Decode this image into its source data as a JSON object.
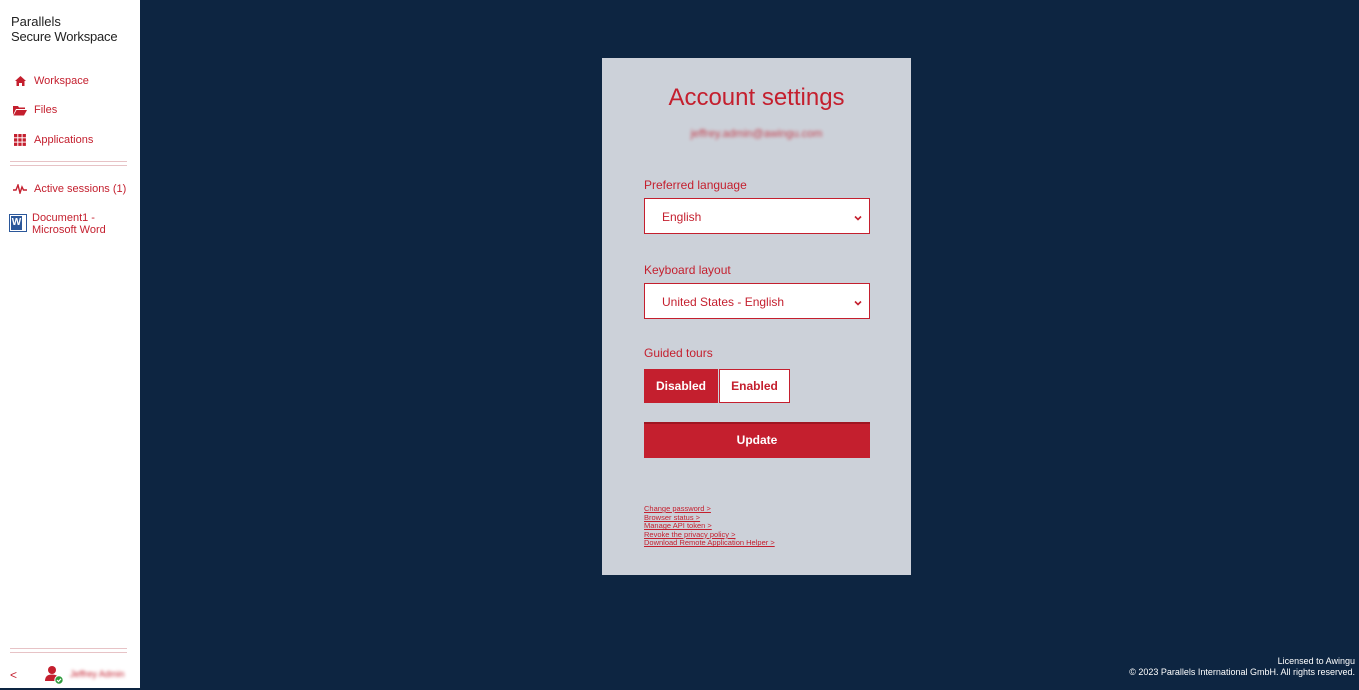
{
  "brand": {
    "line1": "Parallels",
    "line2": "Secure Workspace"
  },
  "sidebar": {
    "items": [
      {
        "label": "Workspace",
        "icon": "home-icon"
      },
      {
        "label": "Files",
        "icon": "folder-icon"
      },
      {
        "label": "Applications",
        "icon": "grid-icon"
      }
    ],
    "sessions_label": "Active sessions (1)",
    "sessions": [
      {
        "label": "Document1 - Microsoft Word",
        "icon": "word-icon"
      }
    ],
    "collapse_label": "<",
    "user_name": "Jeffrey Admin"
  },
  "panel": {
    "title": "Account settings",
    "email": "jeffrey.admin@awingu.com",
    "preferred_language_label": "Preferred language",
    "preferred_language_value": "English",
    "keyboard_layout_label": "Keyboard layout",
    "keyboard_layout_value": "United States - English",
    "guided_tours_label": "Guided tours",
    "disabled_label": "Disabled",
    "enabled_label": "Enabled",
    "update_label": "Update",
    "links": [
      "Change password >",
      "Browser status >",
      "Manage API token >",
      "Revoke the privacy policy >",
      "Download Remote Application Helper >"
    ]
  },
  "footer": {
    "line1": "Licensed to Awingu",
    "line2": "© 2023 Parallels International GmbH. All rights reserved."
  },
  "colors": {
    "accent": "#c41f2e",
    "background": "#0d2541",
    "panel": "#ccd1d9"
  }
}
